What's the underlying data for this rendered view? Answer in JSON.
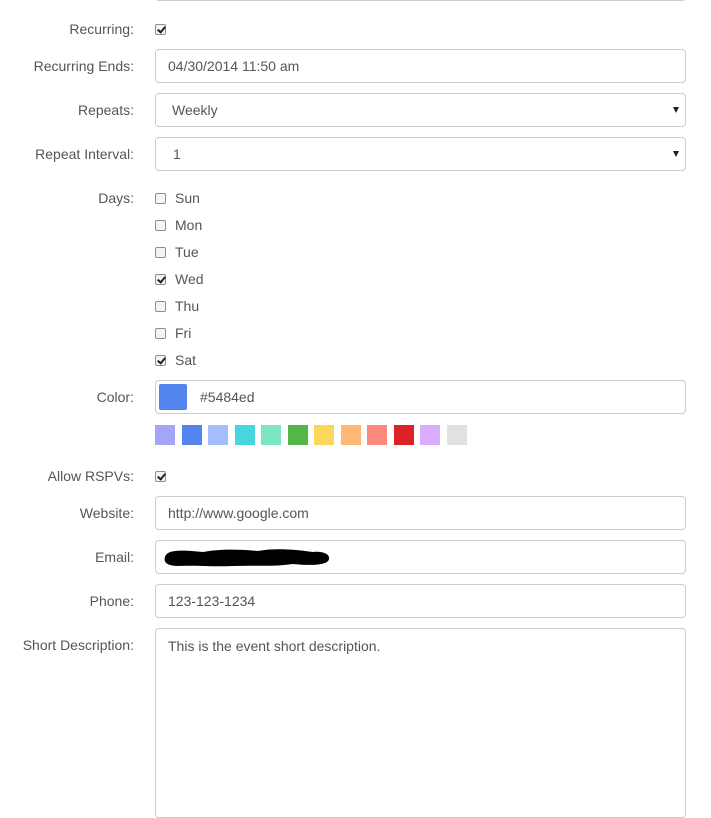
{
  "form": {
    "recurring": {
      "label": "Recurring:",
      "checked": true
    },
    "recurring_ends": {
      "label": "Recurring Ends:",
      "value": "04/30/2014 11:50 am"
    },
    "repeats": {
      "label": "Repeats:",
      "value": "Weekly"
    },
    "repeat_interval": {
      "label": "Repeat Interval:",
      "value": "1"
    },
    "days": {
      "label": "Days:",
      "items": [
        {
          "label": "Sun",
          "checked": false
        },
        {
          "label": "Mon",
          "checked": false
        },
        {
          "label": "Tue",
          "checked": false
        },
        {
          "label": "Wed",
          "checked": true
        },
        {
          "label": "Thu",
          "checked": false
        },
        {
          "label": "Fri",
          "checked": false
        },
        {
          "label": "Sat",
          "checked": true
        }
      ]
    },
    "color": {
      "label": "Color:",
      "value": "#5484ed",
      "swatches": [
        "#a4a4f8",
        "#5484ed",
        "#a4bdfc",
        "#46d6db",
        "#7ae7bf",
        "#51b749",
        "#fbd75b",
        "#ffb878",
        "#ff887c",
        "#dc2127",
        "#dbadff",
        "#e1e1e1"
      ]
    },
    "allow_rsvps": {
      "label": "Allow RSPVs:",
      "checked": true
    },
    "website": {
      "label": "Website:",
      "value": "http://www.google.com"
    },
    "email": {
      "label": "Email:",
      "redacted": true
    },
    "phone": {
      "label": "Phone:",
      "value": "123-123-1234"
    },
    "short_description": {
      "label": "Short Description:",
      "value": "This is the event short description."
    }
  }
}
